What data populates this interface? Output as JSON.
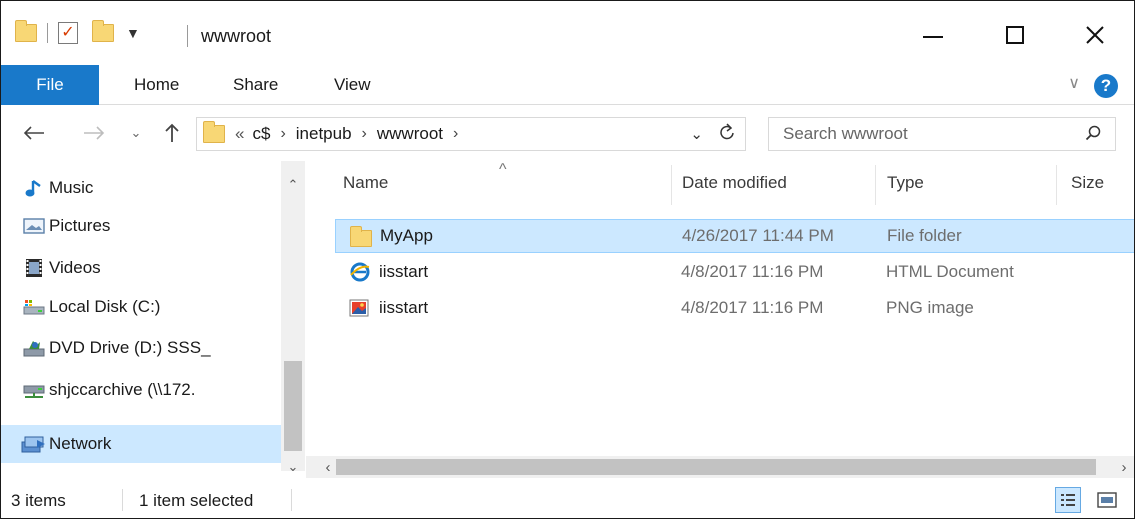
{
  "window": {
    "title": "wwwroot",
    "controls": {
      "minimize": "—",
      "maximize": "☐",
      "close": "✕"
    }
  },
  "ribbon": {
    "tabs": [
      {
        "label": "File",
        "active": true
      },
      {
        "label": "Home"
      },
      {
        "label": "Share"
      },
      {
        "label": "View"
      }
    ],
    "help_label": "?"
  },
  "address": {
    "prefix": "«",
    "crumbs": [
      "c$",
      "inetpub",
      "wwwroot"
    ],
    "search_placeholder": "Search wwwroot"
  },
  "nav_pane": {
    "items": [
      {
        "label": "Music",
        "icon": "music-icon"
      },
      {
        "label": "Pictures",
        "icon": "pictures-icon"
      },
      {
        "label": "Videos",
        "icon": "videos-icon"
      },
      {
        "label": "Local Disk (C:)",
        "icon": "local-disk-icon"
      },
      {
        "label": "DVD Drive (D:) SSS_",
        "icon": "dvd-drive-icon"
      },
      {
        "label": "shjccarchive (\\\\172.",
        "icon": "network-drive-icon"
      },
      {
        "label": "Network",
        "icon": "network-icon",
        "selected": true
      }
    ]
  },
  "file_list": {
    "columns": [
      "Name",
      "Date modified",
      "Type",
      "Size"
    ],
    "rows": [
      {
        "name": "MyApp",
        "date": "4/26/2017 11:44 PM",
        "type": "File folder",
        "icon": "folder-icon",
        "selected": true
      },
      {
        "name": "iisstart",
        "date": "4/8/2017 11:16 PM",
        "type": "HTML Document",
        "icon": "html-document-icon"
      },
      {
        "name": "iisstart",
        "date": "4/8/2017 11:16 PM",
        "type": "PNG image",
        "icon": "png-image-icon"
      }
    ]
  },
  "status": {
    "count": "3 items",
    "selection": "1 item selected"
  },
  "colors": {
    "accent": "#1979ca",
    "selection": "#cce8ff",
    "folder": "#f8d775"
  }
}
